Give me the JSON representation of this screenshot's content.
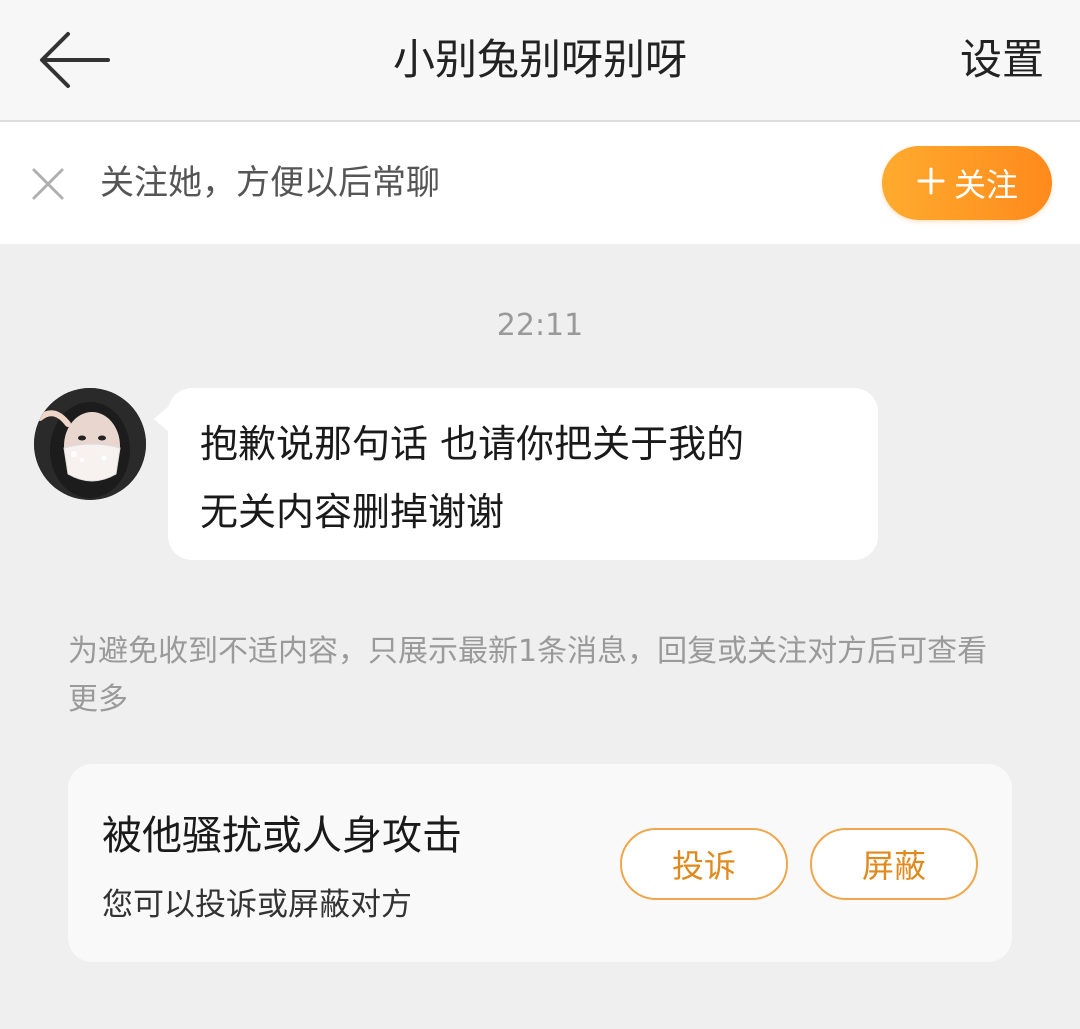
{
  "header": {
    "back_icon": "arrow-left-icon",
    "title": "小别兔别呀别呀",
    "settings_label": "设置"
  },
  "follow_bar": {
    "close_icon": "close-icon",
    "tip": "关注她，方便以后常聊",
    "follow_label": "关注",
    "follow_icon": "plus-icon",
    "accent_color": "#ff9a24"
  },
  "chat": {
    "timestamp": "22:11",
    "messages": [
      {
        "avatar": "avatar",
        "line1": "抱歉说那句话 也请你把关于我的",
        "line2": "无关内容删掉谢谢"
      }
    ]
  },
  "notice": {
    "text": "为避免收到不适内容，只展示最新1条消息，回复或关注对方后可查看更多"
  },
  "report": {
    "title": "被他骚扰或人身攻击",
    "subtitle": "您可以投诉或屏蔽对方",
    "complain_label": "投诉",
    "block_label": "屏蔽"
  }
}
